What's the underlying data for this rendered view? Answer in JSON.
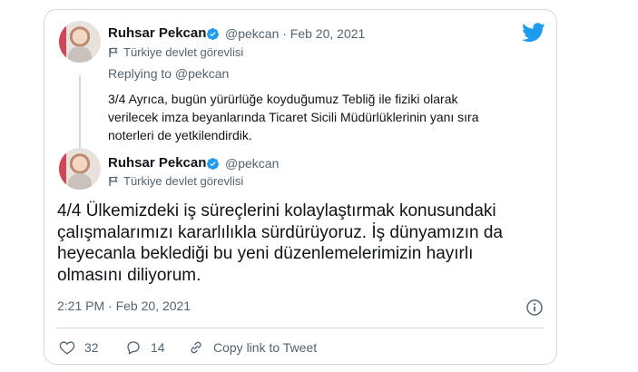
{
  "brand": {
    "icon": "twitter-bird-icon",
    "color": "#1d9bf0"
  },
  "quoted_tweet": {
    "author_name": "Ruhsar Pekcan",
    "handle_date": "@pekcan · Feb 20, 2021",
    "label": "Türkiye devlet görevlisi",
    "replying_to": "Replying to @pekcan",
    "text": "3/4 Ayrıca, bugün yürürlüğe koyduğumuz Tebliğ ile fiziki olarak verilecek imza beyanlarında Ticaret Sicili Müdürlüklerinin yanı sıra noterleri de yetkilendirdik."
  },
  "main_tweet": {
    "author_name": "Ruhsar Pekcan",
    "handle": "@pekcan",
    "label": "Türkiye devlet görevlisi",
    "text": "4/4 Ülkemizdeki iş süreçlerini kolaylaştırmak konusundaki çalışmalarımızı kararlılıkla sürdürüyoruz. İş dünyamızın da heyecanla beklediği bu yeni düzenlemelerimizin hayırlı olmasını diliyorum.",
    "timestamp": "2:21 PM · Feb 20, 2021"
  },
  "actions": {
    "likes": "32",
    "replies": "14",
    "copy_link": "Copy link to Tweet"
  },
  "colors": {
    "verified": "#1d9bf0",
    "muted": "#536471",
    "border": "#cfd9de"
  }
}
